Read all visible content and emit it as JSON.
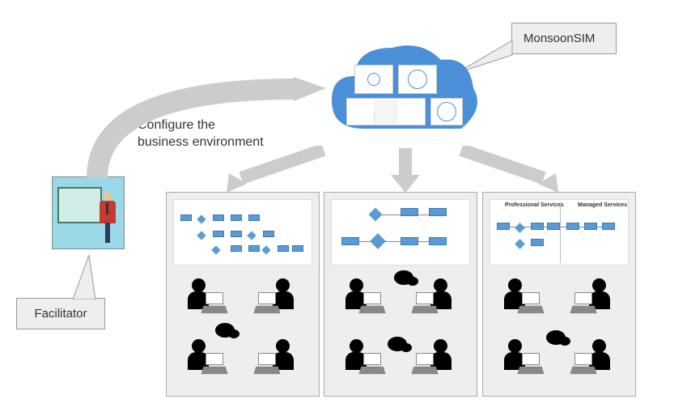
{
  "labels": {
    "monsoonsim": "MonsoonSIM",
    "facilitator": "Facilitator",
    "configure": "Configure the\nbusiness environment"
  },
  "cloud": {
    "thumbs": [
      "content-thumb-1",
      "content-thumb-2",
      "content-thumb-3",
      "content-thumb-4"
    ]
  },
  "panels": [
    {
      "diagram": "process-1",
      "headers": [
        "",
        ""
      ]
    },
    {
      "diagram": "process-2",
      "headers": [
        "",
        ""
      ]
    },
    {
      "diagram": "process-3",
      "headers": [
        "Professional Services",
        "Managed Services"
      ]
    }
  ]
}
